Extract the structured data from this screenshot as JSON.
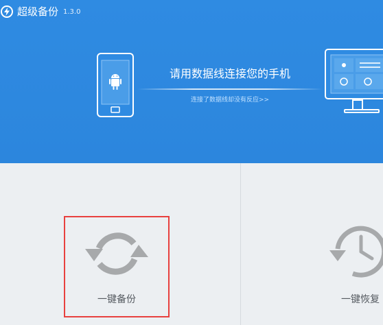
{
  "app": {
    "title": "超级备份",
    "version": "1.3.0"
  },
  "connect": {
    "title": "请用数据线连接您的手机",
    "link": "连接了数据线却没有反应>>"
  },
  "actions": {
    "backup_label": "一键备份",
    "restore_label": "一键恢复"
  },
  "icons": {
    "app_logo": "lightning-circle-icon",
    "phone": "android-phone-icon",
    "monitor": "computer-monitor-icon",
    "backup": "sync-arrows-icon",
    "restore": "clock-restore-icon"
  },
  "colors": {
    "header_blue": "#2e89e0",
    "panel_bg": "#eceff2",
    "icon_gray": "#a7a9ab",
    "highlight_red": "#e8403e"
  }
}
